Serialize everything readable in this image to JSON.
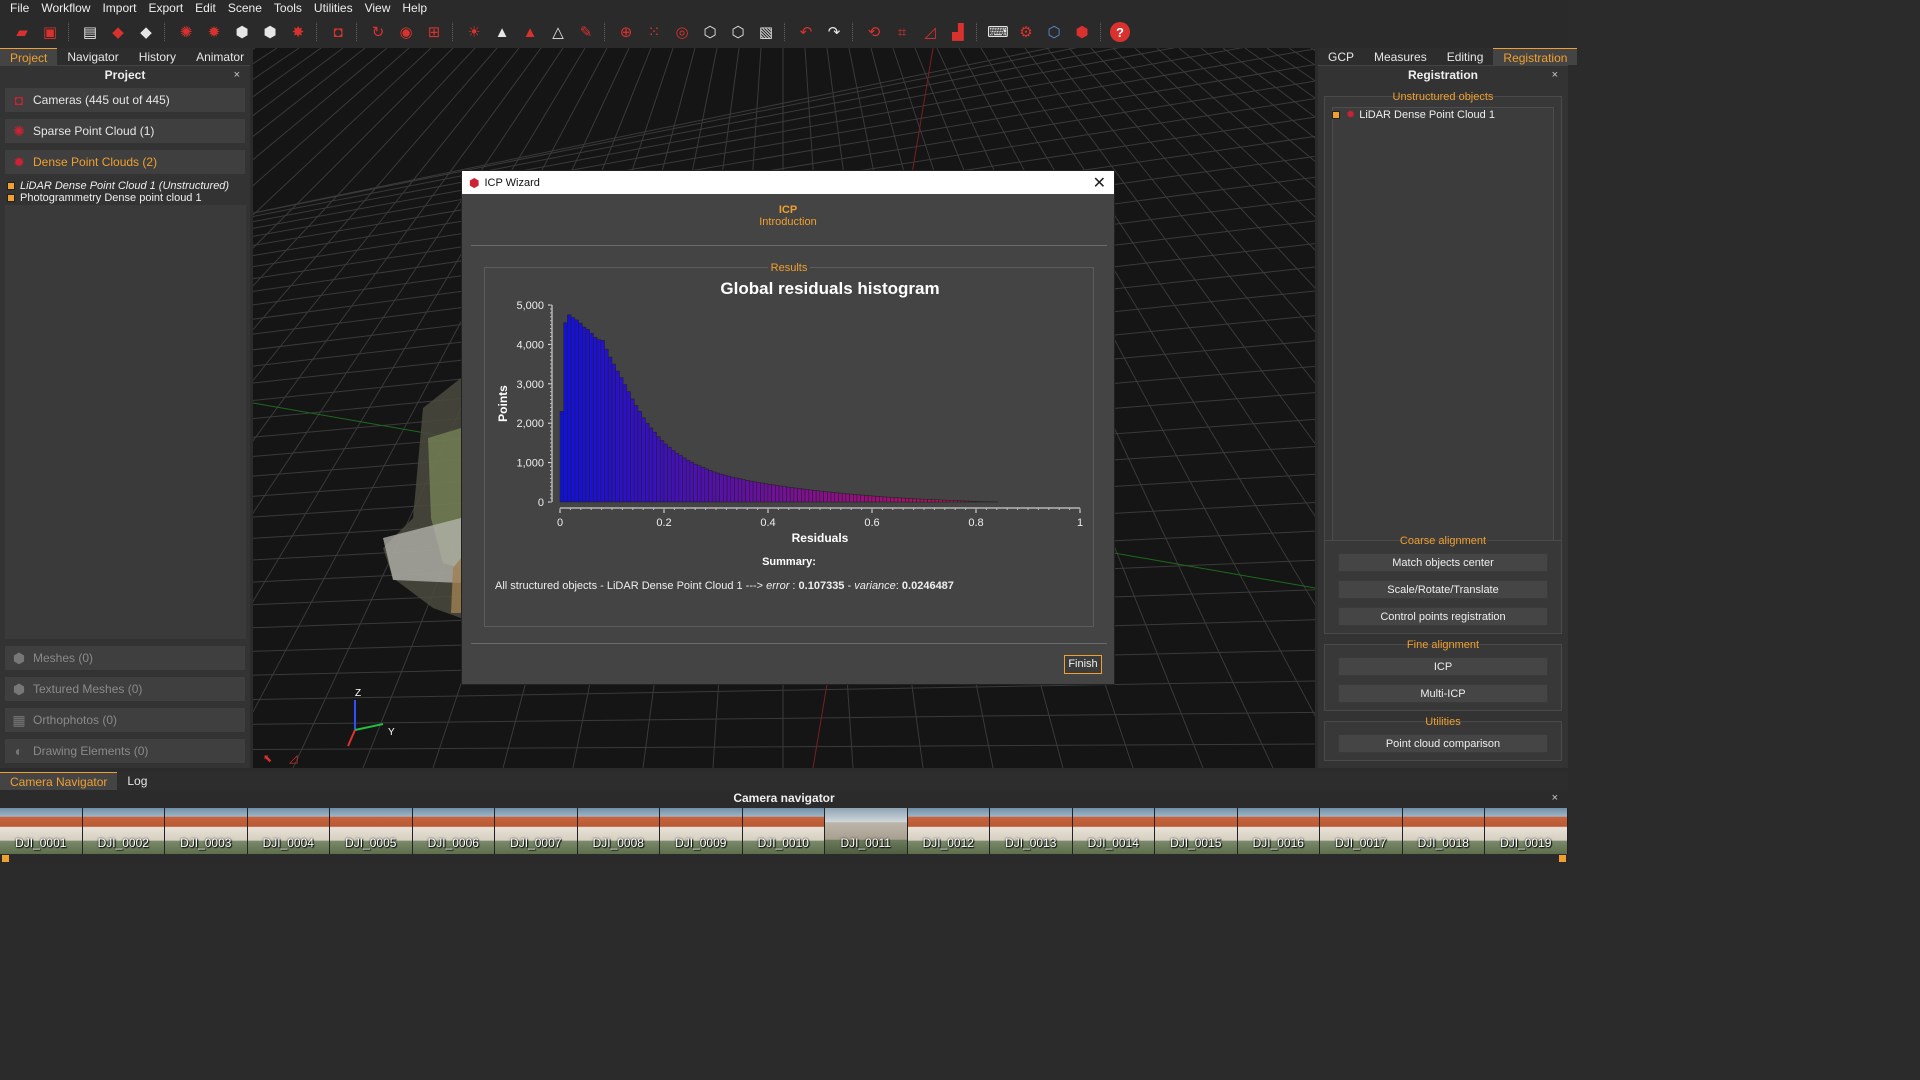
{
  "menu": [
    "File",
    "Workflow",
    "Import",
    "Export",
    "Edit",
    "Scene",
    "Tools",
    "Utilities",
    "View",
    "Help"
  ],
  "left_panel": {
    "tabs": [
      "Project",
      "Navigator",
      "History",
      "Animator"
    ],
    "title": "Project",
    "close": "×",
    "cameras": "Cameras (445 out of 445)",
    "sparse": "Sparse Point Cloud (1)",
    "dense": "Dense Point Clouds (2)",
    "dense_items": [
      "LiDAR Dense Point Cloud 1 (Unstructured)",
      "Photogrammetry Dense point cloud 1"
    ],
    "meshes": "Meshes (0)",
    "textured": "Textured Meshes (0)",
    "ortho": "Orthophotos (0)",
    "drawing": "Drawing Elements (0)"
  },
  "right_panel": {
    "tabs": [
      "GCP",
      "Measures",
      "Editing",
      "Registration"
    ],
    "title": "Registration",
    "close": "×",
    "unstructured_label": "Unstructured objects",
    "unstructured_item": "LiDAR Dense Point Cloud 1",
    "coarse_label": "Coarse alignment",
    "coarse_buttons": [
      "Match objects center",
      "Scale/Rotate/Translate",
      "Control points registration"
    ],
    "fine_label": "Fine alignment",
    "fine_buttons": [
      "ICP",
      "Multi-ICP"
    ],
    "utilities_label": "Utilities",
    "utilities_buttons": [
      "Point cloud comparison"
    ]
  },
  "viewport": {
    "axis_z": "Z",
    "axis_y": "Y"
  },
  "dialog": {
    "title": "ICP Wizard",
    "close": "✕",
    "step_title": "ICP",
    "step_subtitle": "Introduction",
    "results_label": "Results",
    "summary_label": "Summary:",
    "summary_prefix": "All structured objects - LiDAR Dense Point Cloud 1 ---> ",
    "error_label": "error",
    "error_value": "0.107335",
    "variance_label": "variance",
    "variance_value": "0.0246487",
    "finish": "Finish"
  },
  "chart_data": {
    "type": "bar",
    "title": "Global residuals histogram",
    "xlabel": "Residuals",
    "ylabel": "Points",
    "xlim": [
      0,
      1
    ],
    "ylim": [
      0,
      5000
    ],
    "xticks": [
      "0",
      "0.2",
      "0.4",
      "0.6",
      "0.8",
      "1"
    ],
    "yticks": [
      "0",
      "1,000",
      "2,000",
      "3,000",
      "4,000",
      "5,000"
    ],
    "bin_width": 0.00714,
    "values": [
      2300,
      4550,
      4750,
      4680,
      4620,
      4540,
      4440,
      4380,
      4280,
      4180,
      4120,
      4100,
      3880,
      3680,
      3500,
      3320,
      3160,
      2980,
      2800,
      2620,
      2450,
      2300,
      2140,
      2000,
      1880,
      1770,
      1660,
      1560,
      1470,
      1390,
      1310,
      1240,
      1180,
      1120,
      1060,
      1010,
      960,
      920,
      880,
      840,
      800,
      765,
      735,
      705,
      680,
      655,
      630,
      610,
      590,
      570,
      550,
      530,
      510,
      495,
      480,
      465,
      450,
      435,
      420,
      405,
      390,
      378,
      366,
      354,
      342,
      330,
      318,
      307,
      296,
      285,
      274,
      264,
      254,
      244,
      234,
      225,
      216,
      207,
      198,
      190,
      182,
      174,
      166,
      158,
      150,
      143,
      136,
      129,
      122,
      116,
      110,
      104,
      98,
      92,
      87,
      82,
      77,
      72,
      68,
      64,
      60,
      56,
      52,
      48,
      44,
      40,
      36,
      32,
      28,
      24,
      20,
      16,
      12,
      9,
      6,
      4,
      3,
      2
    ],
    "colors": [
      "#1010e0",
      "#c01060"
    ],
    "grid": false,
    "legend": "none"
  },
  "bottom": {
    "tabs": [
      "Camera Navigator",
      "Log"
    ],
    "title": "Camera navigator",
    "close": "×",
    "thumbnails": [
      "DJI_0001",
      "DJI_0002",
      "DJI_0003",
      "DJI_0004",
      "DJI_0005",
      "DJI_0006",
      "DJI_0007",
      "DJI_0008",
      "DJI_0009",
      "DJI_0010",
      "DJI_0011",
      "DJI_0012",
      "DJI_0013",
      "DJI_0014",
      "DJI_0015",
      "DJI_0016",
      "DJI_0017",
      "DJI_0018",
      "DJI_0019"
    ]
  },
  "colors": {
    "accent": "#f0a030",
    "brand_red": "#d9322e"
  }
}
